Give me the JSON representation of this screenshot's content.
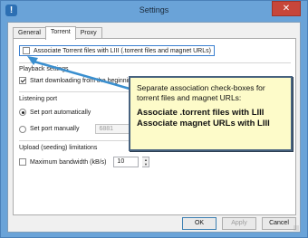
{
  "window": {
    "title": "Settings",
    "close_glyph": "✕",
    "app_icon_glyph": "!"
  },
  "tabs": [
    {
      "label": "General",
      "active": false
    },
    {
      "label": "Torrent",
      "active": true
    },
    {
      "label": "Proxy",
      "active": false
    }
  ],
  "torrent": {
    "associate_label": "Associate Torrent files with LIII (.torrent files and magnet URLs)",
    "associate_checked": false,
    "playback_label": "Playback settings",
    "start_download_label": "Start downloading from the beginning to",
    "start_download_checked": true,
    "listening_port_label": "Listening port",
    "set_port_auto_label": "Set port automatically",
    "set_port_auto_selected": true,
    "set_port_manual_label": "Set port manually",
    "set_port_manual_selected": false,
    "port_value": "6881",
    "upload_label": "Upload (seeding) limitations",
    "max_bandwidth_label": "Maximum bandwidth (kB/s)",
    "max_bandwidth_checked": false,
    "bandwidth_value": "10"
  },
  "buttons": {
    "ok": "OK",
    "apply": "Apply",
    "cancel": "Cancel"
  },
  "callout": {
    "line1": "Separate association check-boxes for torrent files and magnet URLs:",
    "line2": "Associate .torrent files with LIII",
    "line3": "Associate magnet URLs with LIII"
  },
  "colors": {
    "accent": "#3a7fd0",
    "callout_bg": "#fdfbc9",
    "callout_border": "#47627f",
    "arrow": "#3a8fcf"
  }
}
